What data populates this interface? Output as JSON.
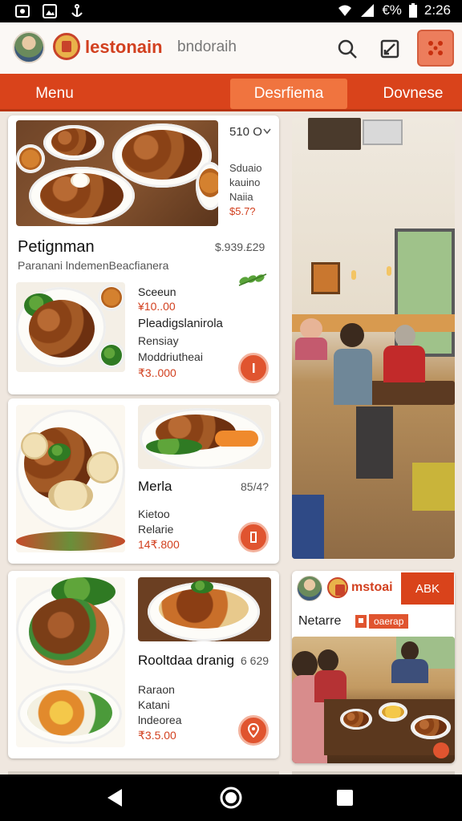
{
  "status": {
    "battery": "€%",
    "time": "2:26"
  },
  "appbar": {
    "brand": "lestonain",
    "subtitle": "bndoraih"
  },
  "tabs": [
    "Menu",
    "Desrfiema",
    "Dovnese"
  ],
  "card1": {
    "header_price": "510 O",
    "side_lines": [
      "Sduaio",
      "kauino",
      "Naiia"
    ],
    "side_price": "$5.7?",
    "title": "Petignman",
    "title_price": "$.939.£29",
    "subtitle": "Paranani lndemenBeacfianera",
    "item_name": "Sceeun",
    "item_price": "¥10..00",
    "item_lines": [
      "Pleadigslanirola",
      "Rensiay",
      "Moddriutheai"
    ],
    "item_price2": "₹3..000"
  },
  "card2": {
    "title": "Merla",
    "price": "85/4?",
    "lines": [
      "Kietoo",
      "Relarie"
    ],
    "line_price": "14₹.800"
  },
  "card3": {
    "title": "Rooltdaa dranig",
    "price": "6 629",
    "lines": [
      "Raraon",
      "Katani",
      "lndeorea"
    ],
    "line_price": "₹3.5.00"
  },
  "promo": {
    "name": "mstoai",
    "button": "ABK",
    "label": "Netarre",
    "tag": "oaerap"
  },
  "colors": {
    "accent": "#d9431b",
    "accent_light": "#f0743f"
  }
}
